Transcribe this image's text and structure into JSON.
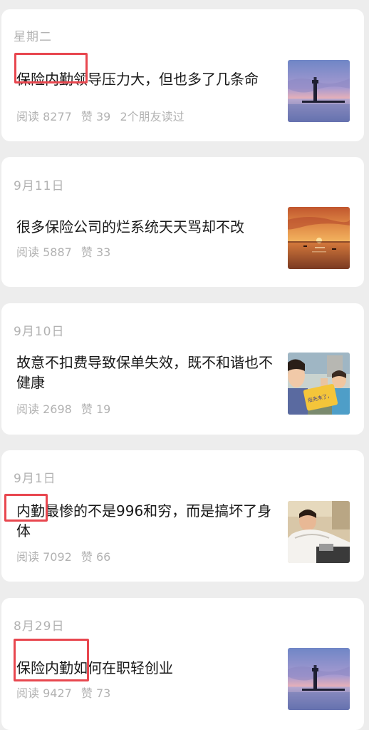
{
  "articles": [
    {
      "date": "星期二",
      "title": "保险内勤领导压力大，但也多了几条命",
      "reads": "阅读 8277",
      "likes": "赞 39",
      "friends": "2个朋友读过",
      "thumb_icon": "lighthouse-dusk-image"
    },
    {
      "date": "9月11日",
      "title": "很多保险公司的烂系统天天骂却不改",
      "reads": "阅读 5887",
      "likes": "赞 33",
      "thumb_icon": "sunset-sea-image"
    },
    {
      "date": "9月10日",
      "title": "故意不扣费导致保单失效，既不和谐也不健康",
      "reads": "阅读 2698",
      "likes": "赞 19",
      "thumb_icon": "people-with-sign-image",
      "thumb_sign_text": "俗先未了，"
    },
    {
      "date": "9月1日",
      "title": "内勤最惨的不是996和穷，而是搞坏了身体",
      "reads": "阅读 7092",
      "likes": "赞 66",
      "thumb_icon": "person-in-hospital-image"
    },
    {
      "date": "8月29日",
      "title": "保险内勤如何在职轻创业",
      "reads": "阅读 9427",
      "likes": "赞 73",
      "thumb_icon": "lighthouse-dusk-image"
    }
  ],
  "colors": {
    "background": "#ededed",
    "card": "#ffffff",
    "title_text": "#191919",
    "meta_text": "#b2b2b2",
    "highlight_box": "#e8474f"
  }
}
